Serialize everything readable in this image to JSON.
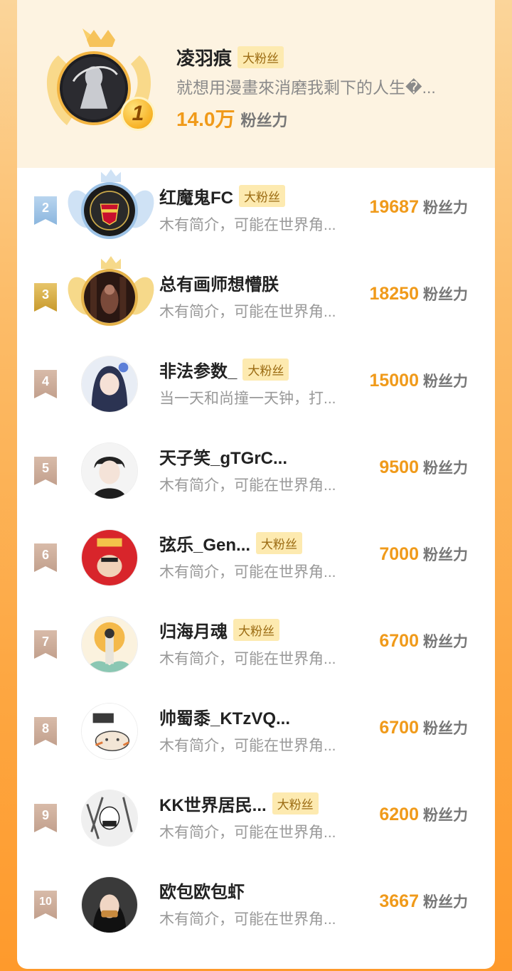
{
  "badge_label": "大粉丝",
  "score_unit": "粉丝力",
  "top": {
    "rank": "1",
    "name": "凌羽痕",
    "bio": "就想用漫畫來消磨我剩下的人生�...",
    "score": "14.0万",
    "has_badge": true
  },
  "rows": [
    {
      "rank": "2",
      "name": "红魔鬼FC",
      "bio": "木有简介，可能在世界角...",
      "score": "19687",
      "has_badge": true,
      "tier": "silver"
    },
    {
      "rank": "3",
      "name": "总有画师想懵朕",
      "bio": "木有简介，可能在世界角...",
      "score": "18250",
      "has_badge": false,
      "tier": "gold"
    },
    {
      "rank": "4",
      "name": "非法参数_",
      "bio": "当一天和尚撞一天钟，打...",
      "score": "15000",
      "has_badge": true,
      "tier": "plain"
    },
    {
      "rank": "5",
      "name": "天子笑_gTGrC...",
      "bio": "木有简介，可能在世界角...",
      "score": "9500",
      "has_badge": false,
      "tier": "plain"
    },
    {
      "rank": "6",
      "name": "弦乐_Gen...",
      "bio": "木有简介，可能在世界角...",
      "score": "7000",
      "has_badge": true,
      "tier": "plain"
    },
    {
      "rank": "7",
      "name": "归海月魂",
      "bio": "木有简介，可能在世界角...",
      "score": "6700",
      "has_badge": true,
      "tier": "plain"
    },
    {
      "rank": "8",
      "name": "帅蜀黍_KTzVQ...",
      "bio": "木有简介，可能在世界角...",
      "score": "6700",
      "has_badge": false,
      "tier": "plain"
    },
    {
      "rank": "9",
      "name": "KK世界居民...",
      "bio": "木有简介，可能在世界角...",
      "score": "6200",
      "has_badge": true,
      "tier": "plain"
    },
    {
      "rank": "10",
      "name": "欧包欧包虾",
      "bio": "木有简介，可能在世界角...",
      "score": "3667",
      "has_badge": false,
      "tier": "plain"
    }
  ],
  "colors": {
    "accent": "#f09a1a",
    "badge_bg": "#fdeab0",
    "top_bg": "#fdf3e1"
  }
}
